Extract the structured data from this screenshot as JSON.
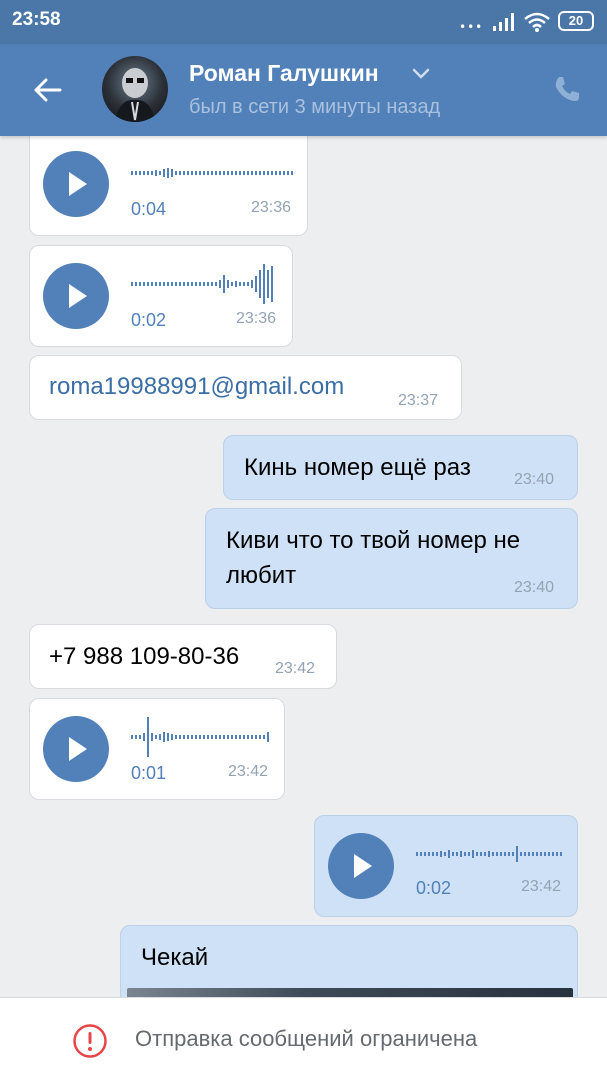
{
  "status_bar": {
    "time": "23:58",
    "battery": "20"
  },
  "header": {
    "contact_name": "Роман Галушкин",
    "last_seen": "был в сети 3 минуты назад",
    "avatar_icon": "avatar-icon"
  },
  "colors": {
    "header": "#5181b8",
    "statusbar": "#4a76a8",
    "out_bubble": "#cfe1f7",
    "in_bubble": "#ffffff",
    "accent": "#5181b8",
    "error": "#e64646"
  },
  "messages": [
    {
      "kind": "voice",
      "dir": "in",
      "duration": "0:04",
      "time": "23:36"
    },
    {
      "kind": "voice",
      "dir": "in",
      "duration": "0:02",
      "time": "23:36"
    },
    {
      "kind": "text",
      "dir": "in",
      "text": "roma19988991@gmail.com",
      "time": "23:37"
    },
    {
      "kind": "text",
      "dir": "out",
      "text": "Кинь номер ещё раз",
      "time": "23:40"
    },
    {
      "kind": "text",
      "dir": "out",
      "line1": "Киви что то твой номер не",
      "line2": "любит",
      "time": "23:40"
    },
    {
      "kind": "text",
      "dir": "in",
      "text": "+7 988 109-80-36",
      "time": "23:42"
    },
    {
      "kind": "voice",
      "dir": "in",
      "duration": "0:01",
      "time": "23:42"
    },
    {
      "kind": "voice",
      "dir": "out",
      "duration": "0:02",
      "time": "23:42"
    },
    {
      "kind": "text",
      "dir": "out",
      "text": "Чекай"
    }
  ],
  "footer": {
    "restriction_text": "Отправка сообщений ограничена"
  }
}
